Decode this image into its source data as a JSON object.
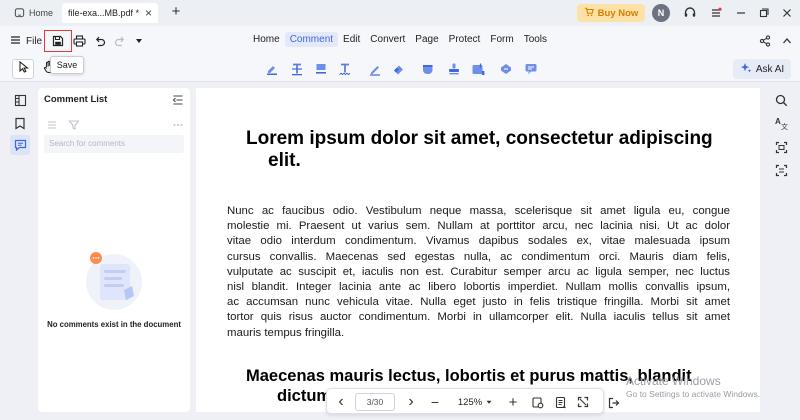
{
  "titlebar": {
    "home_label": "Home",
    "file_tab_label": "file-exa...MB.pdf *",
    "close_glyph": "×",
    "new_tab_glyph": "+",
    "buy_now_label": "Buy Now",
    "avatar_initial": "N"
  },
  "toolbar": {
    "file_label": "File",
    "save_tooltip": "Save",
    "menu": [
      "Home",
      "Comment",
      "Edit",
      "Convert",
      "Page",
      "Protect",
      "Form",
      "Tools"
    ],
    "active_menu": "Comment"
  },
  "annotation_bar": {
    "ask_ai_label": "Ask AI",
    "tools": [
      "highlight-icon",
      "strikethrough-icon",
      "underline-icon",
      "squiggly-icon",
      "pencil-icon",
      "eraser-icon",
      "shape-icon",
      "stamp-icon",
      "attachment-icon",
      "text-box-icon",
      "callout-icon"
    ]
  },
  "comment_panel": {
    "title": "Comment List",
    "search_placeholder": "Search for comments",
    "empty_message": "No comments exist in the document"
  },
  "document": {
    "heading_line1": "Lorem ipsum dolor sit amet, consectetur adipiscing",
    "heading_line2": "elit.",
    "paragraph_lines": [
      "Nunc ac faucibus odio. Vestibulum neque massa, scelerisque sit amet ligula eu, congue",
      "molestie mi. Praesent ut varius sem. Nullam at porttitor arcu, nec lacinia nisi. Ut ac dolor",
      "vitae odio interdum condimentum. Vivamus dapibus sodales ex, vitae malesuada ipsum",
      "cursus convallis. Maecenas sed egestas nulla, ac condimentum orci. Mauris diam felis,",
      "vulputate ac suscipit et, iaculis non est. Curabitur semper arcu ac ligula semper, nec luctus",
      "nisl blandit. Integer lacinia ante ac libero lobortis imperdiet. Nullam mollis convallis ipsum,",
      "ac accumsan nunc vehicula vitae. Nulla eget justo in felis tristique fringilla. Morbi sit amet",
      "tortor quis risus auctor condimentum. Morbi in ullamcorper elit. Nulla iaculis tellus sit amet",
      "mauris tempus fringilla."
    ],
    "subheading_line1": "Maecenas mauris lectus, lobortis et purus mattis, blandit",
    "subheading_line2": "dictum"
  },
  "page_nav": {
    "page_indicator": "3/30",
    "zoom_level": "125%",
    "prev_glyph": "‹",
    "next_glyph": "›",
    "zoom_out_glyph": "−",
    "zoom_in_glyph": "+"
  },
  "watermark": {
    "title": "Activate Windows",
    "subtitle": "Go to Settings to activate Windows."
  },
  "colors": {
    "accent": "#3f68e0",
    "save_highlight": "#e23b3b",
    "buy_now_bg": "#fde2a8",
    "buy_now_text": "#d97d00"
  }
}
